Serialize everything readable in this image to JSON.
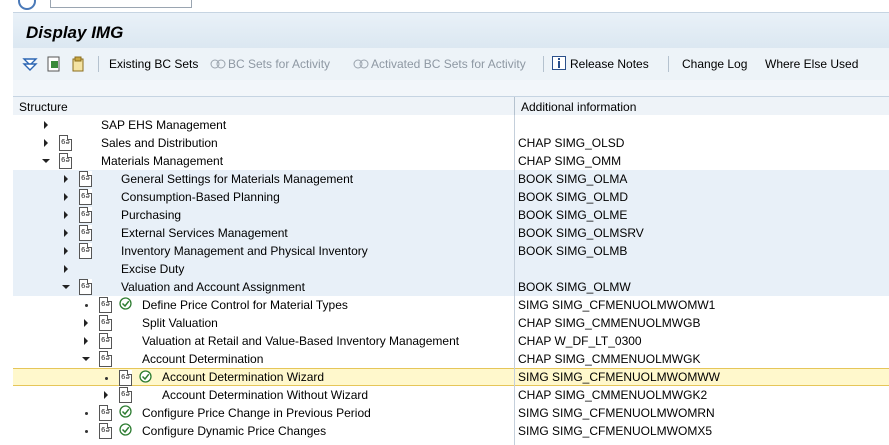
{
  "window": {
    "title": "Display IMG"
  },
  "toolbar": {
    "existing_bc_sets": "Existing BC Sets",
    "bc_sets_for_activity": "BC Sets for Activity",
    "activated_bc_sets": "Activated BC Sets for Activity",
    "release_notes": "Release Notes",
    "change_log": "Change Log",
    "where_else_used": "Where Else Used"
  },
  "columns": {
    "structure": "Structure",
    "additional": "Additional information"
  },
  "rows": [
    {
      "label": "SAP EHS Management",
      "info": ""
    },
    {
      "label": "Sales and Distribution",
      "info": "CHAP SIMG_OLSD"
    },
    {
      "label": "Materials Management",
      "info": "CHAP SIMG_OMM"
    },
    {
      "label": "General Settings for Materials Management",
      "info": "BOOK SIMG_OLMA"
    },
    {
      "label": "Consumption-Based Planning",
      "info": "BOOK SIMG_OLMD"
    },
    {
      "label": "Purchasing",
      "info": "BOOK SIMG_OLME"
    },
    {
      "label": "External Services Management",
      "info": "BOOK SIMG_OLMSRV"
    },
    {
      "label": "Inventory Management and Physical Inventory",
      "info": "BOOK SIMG_OLMB"
    },
    {
      "label": "Excise Duty",
      "info": ""
    },
    {
      "label": "Valuation and Account Assignment",
      "info": "BOOK SIMG_OLMW"
    },
    {
      "label": "Define Price Control for Material Types",
      "info": "SIMG SIMG_CFMENUOLMWOMW1"
    },
    {
      "label": "Split Valuation",
      "info": "CHAP SIMG_CMMENUOLMWGB"
    },
    {
      "label": "Valuation at Retail and Value-Based Inventory Management",
      "info": "CHAP W_DF_LT_0300"
    },
    {
      "label": "Account Determination",
      "info": "CHAP SIMG_CMMENUOLMWGK"
    },
    {
      "label": "Account Determination Wizard",
      "info": "SIMG SIMG_CFMENUOLMWOMWW"
    },
    {
      "label": "Account Determination Without Wizard",
      "info": "CHAP SIMG_CMMENUOLMWGK2"
    },
    {
      "label": "Configure Price Change in Previous Period",
      "info": "SIMG SIMG_CFMENUOLMWOMRN"
    },
    {
      "label": "Configure Dynamic Price Changes",
      "info": "SIMG SIMG_CFMENUOLMWOMX5"
    }
  ]
}
